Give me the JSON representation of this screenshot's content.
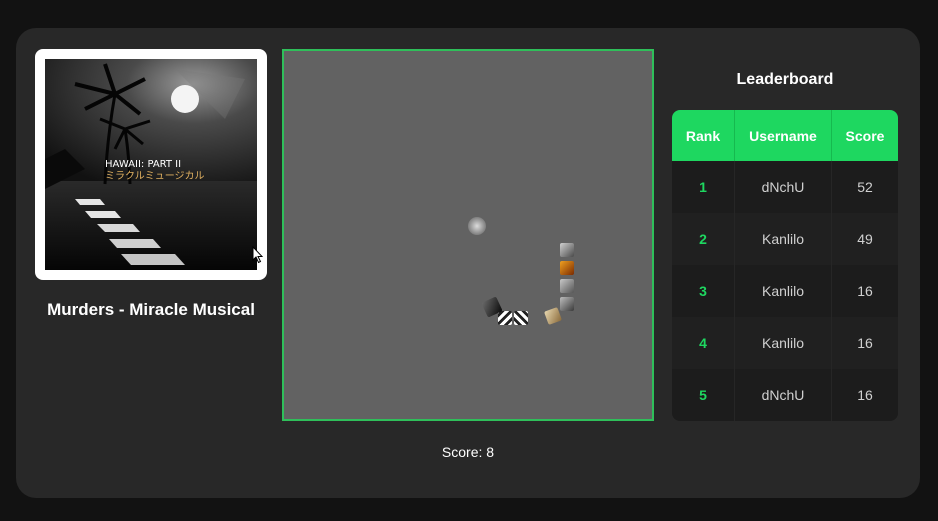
{
  "album": {
    "art_text_line1": "HAWAII: PART II",
    "art_text_line2": "ミラクルミュージカル"
  },
  "song_title": "Murders - Miracle Musical",
  "score_text": "Score: 8",
  "leaderboard": {
    "title": "Leaderboard",
    "headers": [
      "Rank",
      "Username",
      "Score"
    ],
    "rows": [
      {
        "rank": "1",
        "username": "dNchU",
        "score": "52"
      },
      {
        "rank": "2",
        "username": "Kanlilo",
        "score": "49"
      },
      {
        "rank": "3",
        "username": "Kanlilo",
        "score": "16"
      },
      {
        "rank": "4",
        "username": "Kanlilo",
        "score": "16"
      },
      {
        "rank": "5",
        "username": "dNchU",
        "score": "16"
      }
    ]
  },
  "colors": {
    "accent": "#1ed760",
    "board_border": "#2fbf5a",
    "board_bg": "#626262",
    "panel_bg": "#282828"
  },
  "game": {
    "snake_length": 8,
    "food": "album-tile"
  }
}
